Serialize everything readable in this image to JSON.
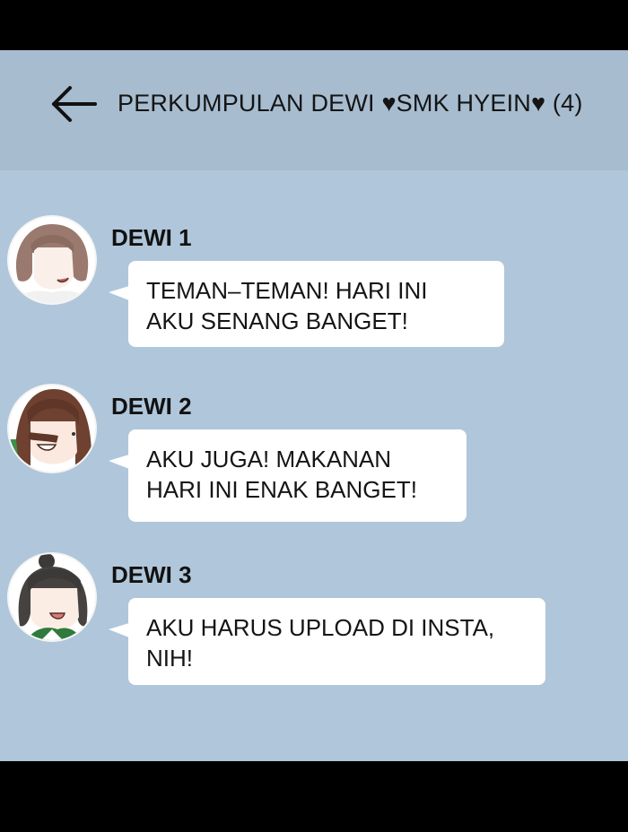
{
  "header": {
    "title": "PERKUMPULAN DEWI ♥SMK HYEIN♥ (4)",
    "back_icon": "arrow-left-icon"
  },
  "messages": [
    {
      "sender": "DEWI 1",
      "text": "TEMAN–TEMAN! HARI INI\nAKU SENANG BANGET!",
      "avatar": "avatar-dewi-1"
    },
    {
      "sender": "DEWI 2",
      "text": "AKU JUGA! MAKANAN\nHARI INI ENAK BANGET!",
      "avatar": "avatar-dewi-2"
    },
    {
      "sender": "DEWI 3",
      "text": "AKU HARUS UPLOAD DI INSTA,\nNIH!",
      "avatar": "avatar-dewi-3"
    }
  ],
  "colors": {
    "chat_background": "#b0c6da",
    "header_background": "#a7bccf",
    "bubble": "#ffffff",
    "letterbox": "#000000"
  }
}
